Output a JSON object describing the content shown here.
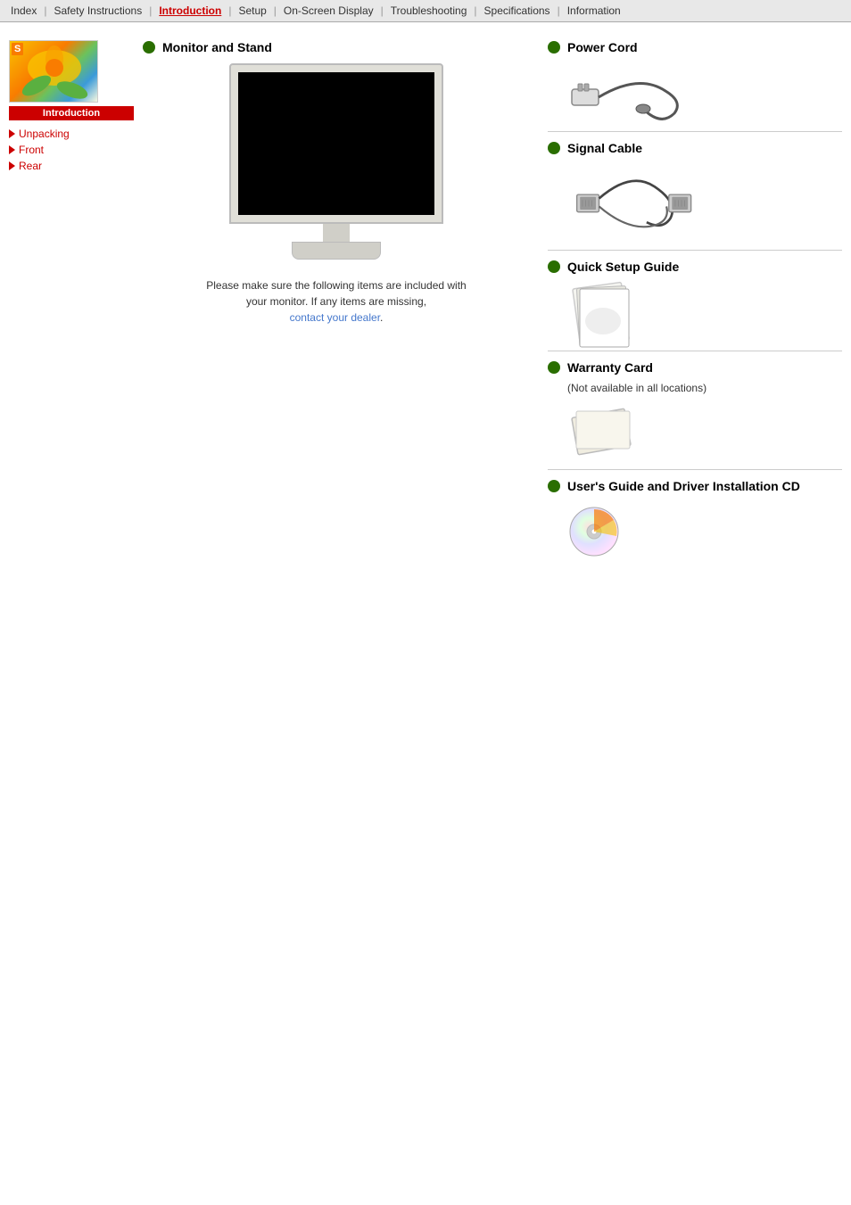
{
  "navbar": {
    "items": [
      {
        "label": "Index",
        "active": false
      },
      {
        "label": "Safety Instructions",
        "active": false
      },
      {
        "label": "Introduction",
        "active": true
      },
      {
        "label": "Setup",
        "active": false
      },
      {
        "label": "On-Screen Display",
        "active": false
      },
      {
        "label": "Troubleshooting",
        "active": false
      },
      {
        "label": "Specifications",
        "active": false
      },
      {
        "label": "Information",
        "active": false
      }
    ]
  },
  "sidebar": {
    "s_label": "S",
    "intro_label": "Introduction",
    "links": [
      {
        "label": "Unpacking",
        "id": "unpacking"
      },
      {
        "label": "Front",
        "id": "front"
      },
      {
        "label": "Rear",
        "id": "rear"
      }
    ]
  },
  "center": {
    "section_title": "Monitor and Stand",
    "caption": "Please make sure the following items are included with your monitor. If any items are missing,",
    "caption_link": "contact your dealer",
    "caption_end": "."
  },
  "right": {
    "items": [
      {
        "title": "Power Cord",
        "subtitle": "",
        "type": "power-cord"
      },
      {
        "title": "Signal Cable",
        "subtitle": "",
        "type": "signal-cable"
      },
      {
        "title": "Quick Setup Guide",
        "subtitle": "",
        "type": "quick-guide"
      },
      {
        "title": "Warranty Card",
        "subtitle": "(Not available in all locations)",
        "type": "warranty"
      },
      {
        "title": "User's Guide and Driver Installation CD",
        "subtitle": "",
        "type": "cd"
      }
    ]
  }
}
